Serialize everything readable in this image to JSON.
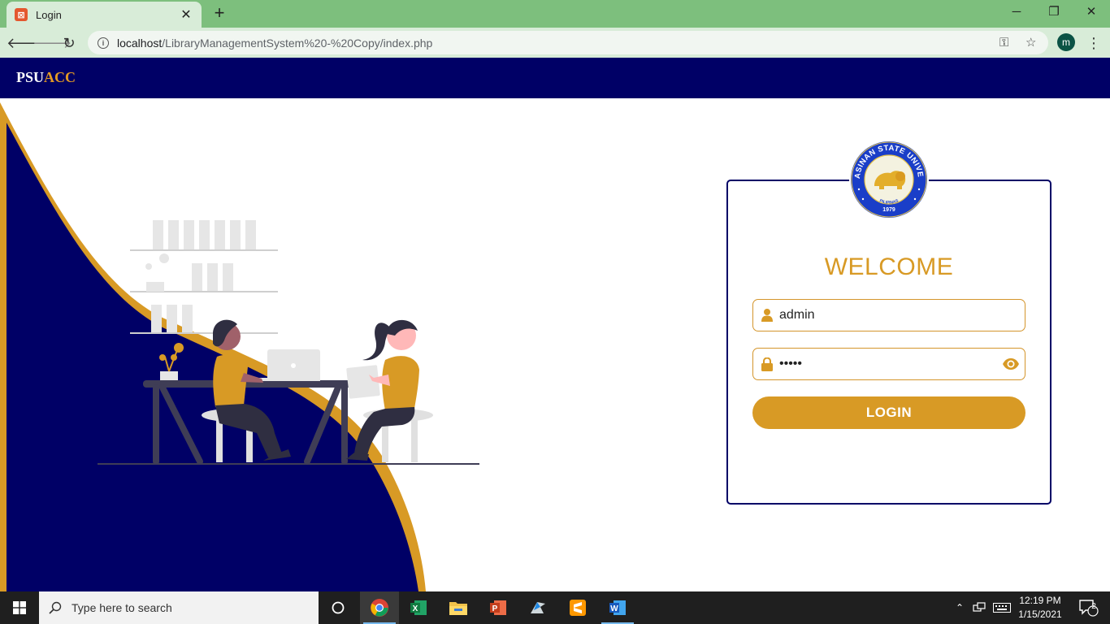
{
  "browser": {
    "tab": {
      "title": "Login",
      "favicon": "xampp-icon"
    },
    "url": {
      "host": "localhost",
      "path": "/LibraryManagementSystem%20-%20Copy/index.php"
    },
    "profile_initial": "m"
  },
  "header": {
    "brand_part1": "PSU",
    "brand_part2": "ACC"
  },
  "login": {
    "title": "WELCOME",
    "username": {
      "value": "admin"
    },
    "password": {
      "value": "admin"
    },
    "button_label": "LOGIN"
  },
  "seal": {
    "upper_text": "PANGASINAN STATE UNIVERSITY",
    "lower_text": "PILIPINAS",
    "year": "1979"
  },
  "taskbar": {
    "search_placeholder": "Type here to search",
    "time": "12:19 PM",
    "date": "1/15/2021",
    "notification_count": "2"
  },
  "colors": {
    "navy": "#000066",
    "gold": "#d89a25",
    "chrome_green": "#7dbf7d"
  }
}
